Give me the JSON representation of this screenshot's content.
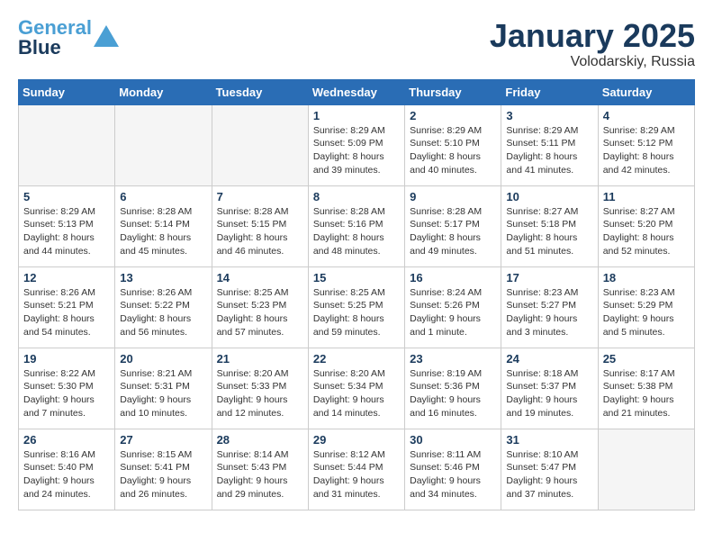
{
  "logo": {
    "line1": "General",
    "line2": "Blue"
  },
  "title": "January 2025",
  "location": "Volodarskiy, Russia",
  "days_header": [
    "Sunday",
    "Monday",
    "Tuesday",
    "Wednesday",
    "Thursday",
    "Friday",
    "Saturday"
  ],
  "weeks": [
    [
      {
        "day": "",
        "info": ""
      },
      {
        "day": "",
        "info": ""
      },
      {
        "day": "",
        "info": ""
      },
      {
        "day": "1",
        "info": "Sunrise: 8:29 AM\nSunset: 5:09 PM\nDaylight: 8 hours\nand 39 minutes."
      },
      {
        "day": "2",
        "info": "Sunrise: 8:29 AM\nSunset: 5:10 PM\nDaylight: 8 hours\nand 40 minutes."
      },
      {
        "day": "3",
        "info": "Sunrise: 8:29 AM\nSunset: 5:11 PM\nDaylight: 8 hours\nand 41 minutes."
      },
      {
        "day": "4",
        "info": "Sunrise: 8:29 AM\nSunset: 5:12 PM\nDaylight: 8 hours\nand 42 minutes."
      }
    ],
    [
      {
        "day": "5",
        "info": "Sunrise: 8:29 AM\nSunset: 5:13 PM\nDaylight: 8 hours\nand 44 minutes."
      },
      {
        "day": "6",
        "info": "Sunrise: 8:28 AM\nSunset: 5:14 PM\nDaylight: 8 hours\nand 45 minutes."
      },
      {
        "day": "7",
        "info": "Sunrise: 8:28 AM\nSunset: 5:15 PM\nDaylight: 8 hours\nand 46 minutes."
      },
      {
        "day": "8",
        "info": "Sunrise: 8:28 AM\nSunset: 5:16 PM\nDaylight: 8 hours\nand 48 minutes."
      },
      {
        "day": "9",
        "info": "Sunrise: 8:28 AM\nSunset: 5:17 PM\nDaylight: 8 hours\nand 49 minutes."
      },
      {
        "day": "10",
        "info": "Sunrise: 8:27 AM\nSunset: 5:18 PM\nDaylight: 8 hours\nand 51 minutes."
      },
      {
        "day": "11",
        "info": "Sunrise: 8:27 AM\nSunset: 5:20 PM\nDaylight: 8 hours\nand 52 minutes."
      }
    ],
    [
      {
        "day": "12",
        "info": "Sunrise: 8:26 AM\nSunset: 5:21 PM\nDaylight: 8 hours\nand 54 minutes."
      },
      {
        "day": "13",
        "info": "Sunrise: 8:26 AM\nSunset: 5:22 PM\nDaylight: 8 hours\nand 56 minutes."
      },
      {
        "day": "14",
        "info": "Sunrise: 8:25 AM\nSunset: 5:23 PM\nDaylight: 8 hours\nand 57 minutes."
      },
      {
        "day": "15",
        "info": "Sunrise: 8:25 AM\nSunset: 5:25 PM\nDaylight: 8 hours\nand 59 minutes."
      },
      {
        "day": "16",
        "info": "Sunrise: 8:24 AM\nSunset: 5:26 PM\nDaylight: 9 hours\nand 1 minute."
      },
      {
        "day": "17",
        "info": "Sunrise: 8:23 AM\nSunset: 5:27 PM\nDaylight: 9 hours\nand 3 minutes."
      },
      {
        "day": "18",
        "info": "Sunrise: 8:23 AM\nSunset: 5:29 PM\nDaylight: 9 hours\nand 5 minutes."
      }
    ],
    [
      {
        "day": "19",
        "info": "Sunrise: 8:22 AM\nSunset: 5:30 PM\nDaylight: 9 hours\nand 7 minutes."
      },
      {
        "day": "20",
        "info": "Sunrise: 8:21 AM\nSunset: 5:31 PM\nDaylight: 9 hours\nand 10 minutes."
      },
      {
        "day": "21",
        "info": "Sunrise: 8:20 AM\nSunset: 5:33 PM\nDaylight: 9 hours\nand 12 minutes."
      },
      {
        "day": "22",
        "info": "Sunrise: 8:20 AM\nSunset: 5:34 PM\nDaylight: 9 hours\nand 14 minutes."
      },
      {
        "day": "23",
        "info": "Sunrise: 8:19 AM\nSunset: 5:36 PM\nDaylight: 9 hours\nand 16 minutes."
      },
      {
        "day": "24",
        "info": "Sunrise: 8:18 AM\nSunset: 5:37 PM\nDaylight: 9 hours\nand 19 minutes."
      },
      {
        "day": "25",
        "info": "Sunrise: 8:17 AM\nSunset: 5:38 PM\nDaylight: 9 hours\nand 21 minutes."
      }
    ],
    [
      {
        "day": "26",
        "info": "Sunrise: 8:16 AM\nSunset: 5:40 PM\nDaylight: 9 hours\nand 24 minutes."
      },
      {
        "day": "27",
        "info": "Sunrise: 8:15 AM\nSunset: 5:41 PM\nDaylight: 9 hours\nand 26 minutes."
      },
      {
        "day": "28",
        "info": "Sunrise: 8:14 AM\nSunset: 5:43 PM\nDaylight: 9 hours\nand 29 minutes."
      },
      {
        "day": "29",
        "info": "Sunrise: 8:12 AM\nSunset: 5:44 PM\nDaylight: 9 hours\nand 31 minutes."
      },
      {
        "day": "30",
        "info": "Sunrise: 8:11 AM\nSunset: 5:46 PM\nDaylight: 9 hours\nand 34 minutes."
      },
      {
        "day": "31",
        "info": "Sunrise: 8:10 AM\nSunset: 5:47 PM\nDaylight: 9 hours\nand 37 minutes."
      },
      {
        "day": "",
        "info": ""
      }
    ]
  ]
}
